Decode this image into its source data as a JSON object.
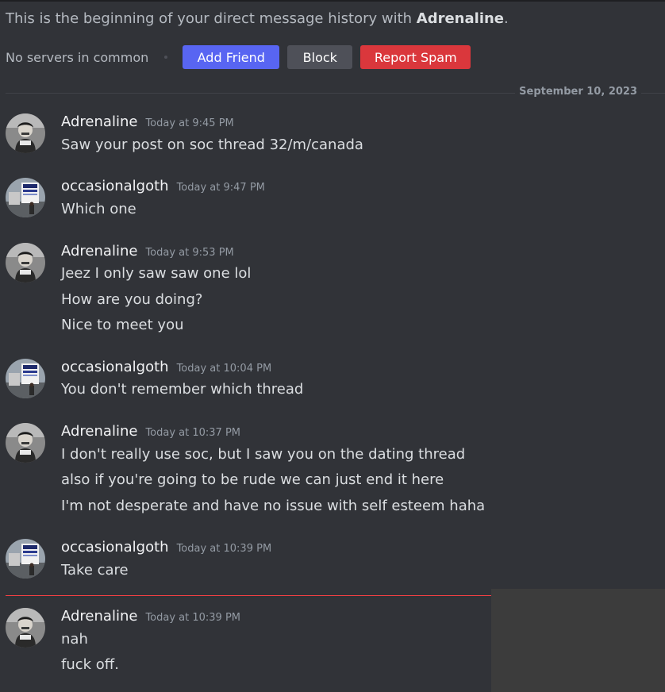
{
  "intro": {
    "prefix": "This is the beginning of your direct message history with ",
    "username": "Adrenaline",
    "suffix": "."
  },
  "actions": {
    "no_servers": "No servers in common",
    "add_friend": "Add Friend",
    "block": "Block",
    "report_spam": "Report Spam"
  },
  "date_divider": "September 10, 2023",
  "messages": [
    {
      "author": "Adrenaline",
      "time": "Today at 9:45 PM",
      "avatar_icon": "man-portrait-avatar",
      "lines": [
        "Saw your post on soc thread 32/m/canada"
      ]
    },
    {
      "author": "occasionalgoth",
      "time": "Today at 9:47 PM",
      "avatar_icon": "building-billboard-avatar",
      "lines": [
        "Which one"
      ]
    },
    {
      "author": "Adrenaline",
      "time": "Today at 9:53 PM",
      "avatar_icon": "man-portrait-avatar",
      "lines": [
        "Jeez I only saw saw one lol",
        "How are you doing?",
        "Nice to meet you"
      ]
    },
    {
      "author": "occasionalgoth",
      "time": "Today at 10:04 PM",
      "avatar_icon": "building-billboard-avatar",
      "lines": [
        "You don't remember which thread"
      ]
    },
    {
      "author": "Adrenaline",
      "time": "Today at 10:37 PM",
      "avatar_icon": "man-portrait-avatar",
      "lines": [
        "I don't really use soc, but I saw you on the dating thread",
        "also if you're going to be rude we can just end it here",
        "I'm not desperate and have no issue with self esteem haha"
      ]
    },
    {
      "author": "occasionalgoth",
      "time": "Today at 10:39 PM",
      "avatar_icon": "building-billboard-avatar",
      "lines": [
        "Take care"
      ]
    },
    {
      "author": "Adrenaline",
      "time": "Today at 10:39 PM",
      "avatar_icon": "man-portrait-avatar",
      "lines": [
        "nah",
        "fuck off."
      ]
    }
  ],
  "colors": {
    "background": "#313338",
    "add_friend": "#5865f2",
    "block": "#4e5058",
    "report_spam": "#da373c",
    "new_messages_divider": "#f23f43"
  }
}
